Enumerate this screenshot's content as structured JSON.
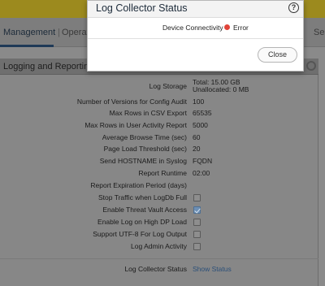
{
  "tabs": {
    "management": "Management",
    "separator": "|",
    "operations": "Operatio",
    "right_partial": "Ses"
  },
  "panel": {
    "title": "Logging and Reporting Setti",
    "rows": [
      {
        "label": "Log Storage",
        "value_line1": "Total: 15.00 GB",
        "value_line2": "Unallocated: 0 MB"
      },
      {
        "label": "Number of Versions for Config Audit",
        "value": "100"
      },
      {
        "label": "Max Rows in CSV Export",
        "value": "65535"
      },
      {
        "label": "Max Rows in User Activity Report",
        "value": "5000"
      },
      {
        "label": "Average Browse Time (sec)",
        "value": "60"
      },
      {
        "label": "Page Load Threshold (sec)",
        "value": "20"
      },
      {
        "label": "Send HOSTNAME in Syslog",
        "value": "FQDN"
      },
      {
        "label": "Report Runtime",
        "value": "02:00"
      },
      {
        "label": "Report Expiration Period (days)",
        "value": ""
      },
      {
        "label": "Stop Traffic when LogDb Full",
        "checked": false
      },
      {
        "label": "Enable Threat Vault Access",
        "checked": true
      },
      {
        "label": "Enable Log on High DP Load",
        "checked": false
      },
      {
        "label": "Support UTF-8 For Log Output",
        "checked": false
      },
      {
        "label": "Log Admin Activity",
        "checked": false
      }
    ],
    "collector_label": "Log Collector Status",
    "collector_link": "Show Status"
  },
  "modal": {
    "title": "Log Collector Status",
    "help": "?",
    "connectivity_label": "Device Connectivity",
    "connectivity_status": "Error",
    "status_color": "#e0443a",
    "close_label": "Close"
  }
}
